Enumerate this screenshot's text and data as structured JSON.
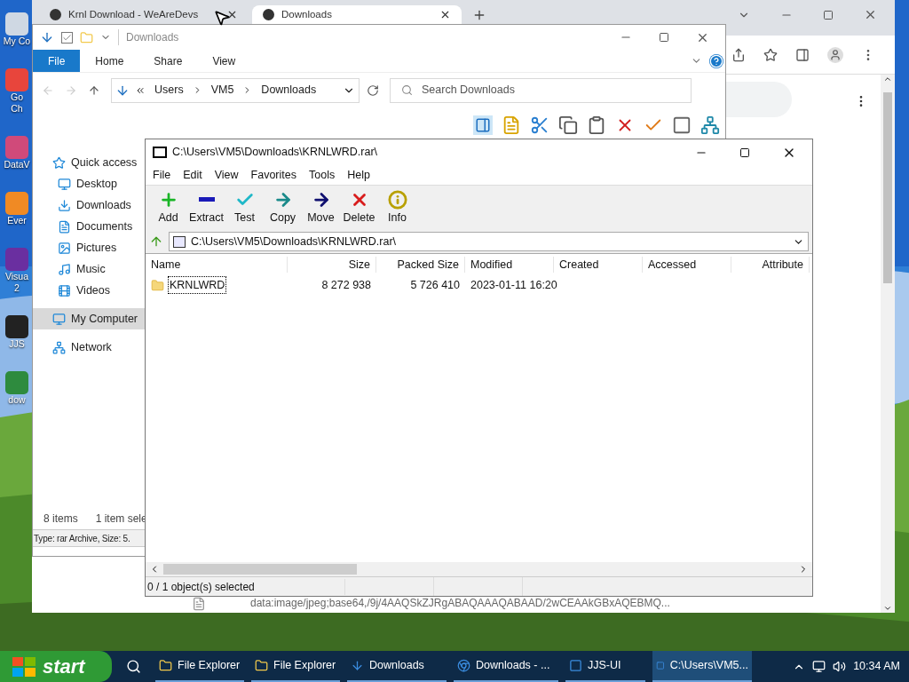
{
  "desktop": {
    "icons": [
      {
        "label": "My Co"
      },
      {
        "label": "Go\nCh"
      },
      {
        "label": "DataV"
      },
      {
        "label": "Ever"
      },
      {
        "label": "Visua\n2"
      },
      {
        "label": "JJS"
      },
      {
        "label": "dow"
      }
    ]
  },
  "browser": {
    "tabs": [
      {
        "title": "Krnl Download - WeAreDevs",
        "selected": false
      },
      {
        "title": "Downloads",
        "selected": true
      }
    ],
    "page_text": "data:image/jpeg;base64,/9j/4AAQSkZJRgABAQAAAQABAAD/2wCEAAkGBxAQEBMQ..."
  },
  "explorer": {
    "title": "Downloads",
    "ribbon_tabs": [
      {
        "label": "File",
        "selected": true
      },
      {
        "label": "Home",
        "selected": false
      },
      {
        "label": "Share",
        "selected": false
      },
      {
        "label": "View",
        "selected": false
      }
    ],
    "path": [
      "Users",
      "VM5",
      "Downloads"
    ],
    "search": {
      "placeholder": "Search Downloads"
    },
    "nav": [
      {
        "label": "Quick access",
        "selected": false,
        "children": [
          {
            "label": "Desktop",
            "selected": false
          },
          {
            "label": "Downloads",
            "selected": false
          },
          {
            "label": "Documents",
            "selected": false
          },
          {
            "label": "Pictures",
            "selected": false
          },
          {
            "label": "Music",
            "selected": false
          },
          {
            "label": "Videos",
            "selected": false
          }
        ]
      },
      {
        "label": "My Computer",
        "selected": true
      },
      {
        "label": "Network",
        "selected": false
      }
    ],
    "status": {
      "count": "8 items",
      "selection": "1 item sele"
    },
    "details": "Type: rar Archive, Size: 5."
  },
  "archiver": {
    "title": "C:\\Users\\VM5\\Downloads\\KRNLWRD.rar\\",
    "menu": [
      "File",
      "Edit",
      "View",
      "Favorites",
      "Tools",
      "Help"
    ],
    "toolbar": [
      {
        "label": "Add"
      },
      {
        "label": "Extract"
      },
      {
        "label": "Test"
      },
      {
        "label": "Copy"
      },
      {
        "label": "Move"
      },
      {
        "label": "Delete"
      },
      {
        "label": "Info"
      }
    ],
    "path": "C:\\Users\\VM5\\Downloads\\KRNLWRD.rar\\",
    "columns": [
      "Name",
      "Size",
      "Packed Size",
      "Modified",
      "Created",
      "Accessed",
      "Attribute"
    ],
    "rows": [
      {
        "cells": [
          "KRNLWRD",
          "8 272 938",
          "5 726 410",
          "2023-01-11 16:20",
          "",
          "",
          ""
        ],
        "focused": true
      }
    ],
    "status": "0 / 1 object(s) selected"
  },
  "taskbar": {
    "start": "start",
    "items": [
      {
        "label": "File Explorer",
        "selected": false
      },
      {
        "label": "File Explorer",
        "selected": false
      },
      {
        "label": "Downloads",
        "selected": false
      },
      {
        "label": "Downloads - ...",
        "selected": false
      },
      {
        "label": "JJS-UI",
        "selected": false
      },
      {
        "label": "C:\\Users\\VM5...",
        "selected": true
      }
    ],
    "time": "10:34 AM"
  }
}
